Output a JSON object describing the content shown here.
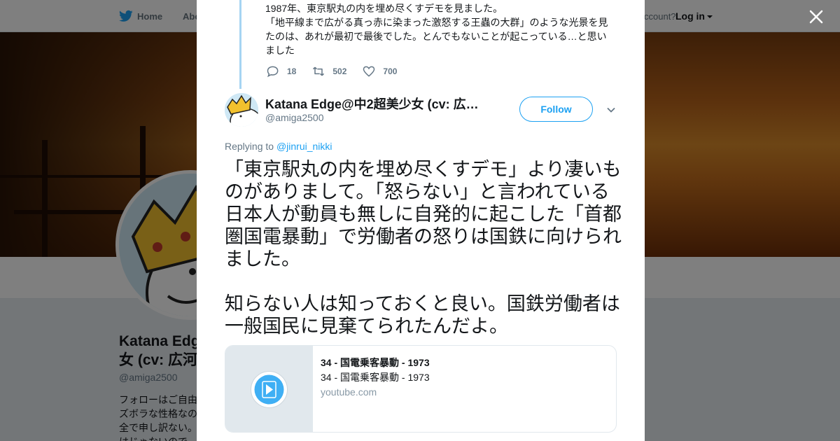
{
  "nav": {
    "home_label": "Home",
    "about_label": "Abo",
    "account_prompt": "ccount?",
    "login_label": "Log in"
  },
  "profile": {
    "name": "Katana Edg\n女 (cv: 広河",
    "handle": "@amiga2500",
    "bio": "フォローはご自由\nズボラな性格なの\n全で申し訳ない。\nはじゃないので"
  },
  "previous_tweet": {
    "text": "1987年、東京駅丸の内を埋め尽くすデモを見ました。\n「地平線まで広がる真っ赤に染まった激怒する王蟲の大群」のような光景を見たのは、あれが最初で最後でした。とんでもないことが起こっている…と思いました",
    "replies": "18",
    "retweets": "502",
    "likes": "700"
  },
  "tweet": {
    "author_name": "Katana Edge@中2超美少女 (cv: 広…",
    "author_handle": "@amiga2500",
    "follow_label": "Follow",
    "replying_prefix": "Replying to",
    "replying_to": "@jinrui_nikki",
    "text": "「東京駅丸の内を埋め尽くすデモ」より凄いものがありまして。「怒らない」と言われている日本人が動員も無しに自発的に起こした「首都圏国電暴動」で労働者の怒りは国鉄に向けられました。\n\n知らない人は知っておくと良い。国鉄労働者は一般国民に見棄てられたんだよ。"
  },
  "card": {
    "title": "34 - 国電乗客暴動 - 1973",
    "description": "34 - 国電乗客暴動 - 1973",
    "domain": "youtube.com"
  },
  "icons": {
    "brand": "twitter-bird-icon",
    "close": "close-icon",
    "reply": "reply-icon",
    "retweet": "retweet-icon",
    "like": "heart-icon",
    "caret": "chevron-down-icon",
    "play": "play-icon"
  },
  "colors": {
    "accent": "#1da1f2",
    "thread_line": "#a6d4f2",
    "muted_text": "#657786"
  }
}
